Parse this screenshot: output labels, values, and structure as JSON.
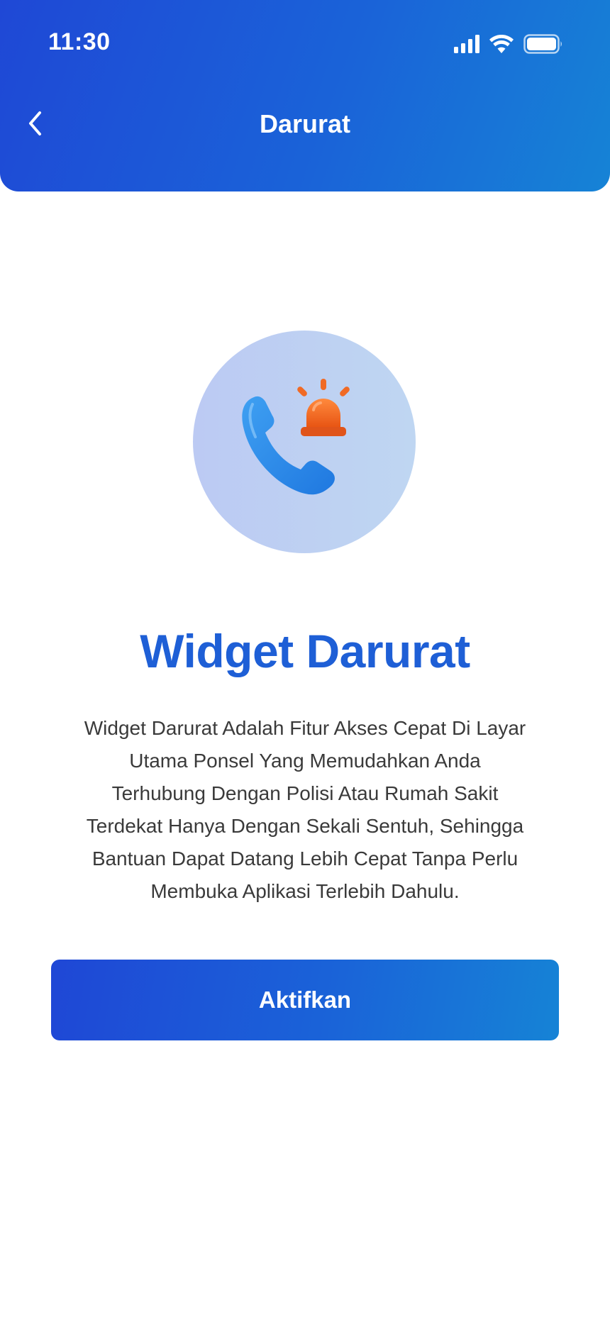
{
  "status_bar": {
    "time": "11:30",
    "icons": [
      "signal-icon",
      "wifi-icon",
      "battery-icon"
    ]
  },
  "header": {
    "title": "Darurat",
    "back_icon": "chevron-left-icon"
  },
  "hero": {
    "icon": "emergency-phone-siren-icon",
    "colors": {
      "circle": "#bfd0f2",
      "phone": "#2f8fec",
      "siren": "#f26a22"
    }
  },
  "content": {
    "headline": "Widget Darurat",
    "description_lines": [
      "Widget Darurat Adalah Fitur Akses Cepat Di Layar",
      "Utama Ponsel Yang Memudahkan Anda",
      "Terhubung Dengan Polisi Atau Rumah Sakit",
      "Terdekat Hanya Dengan Sekali Sentuh, Sehingga",
      "Bantuan Dapat Datang Lebih Cepat Tanpa Perlu",
      "Membuka Aplikasi Terlebih Dahulu."
    ]
  },
  "cta": {
    "label": "Aktifkan"
  },
  "colors": {
    "brand_primary": "#1f48d6",
    "brand_secondary": "#1683d6",
    "headline": "#1e5fd6",
    "body_text": "#3a3a3a",
    "background": "#ffffff"
  }
}
